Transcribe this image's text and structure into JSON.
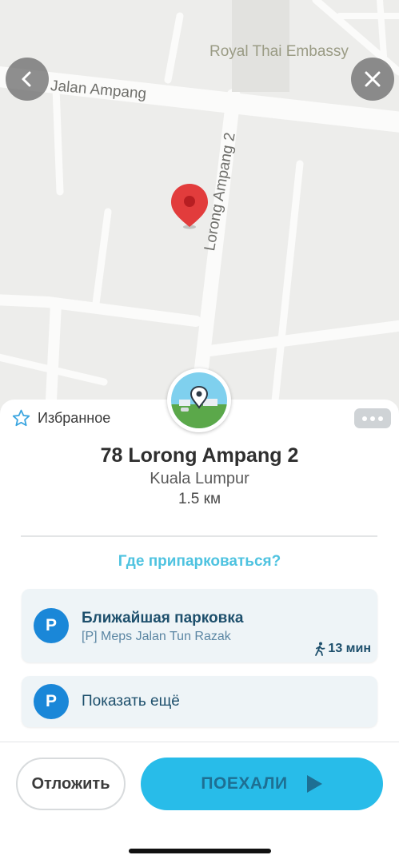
{
  "map": {
    "street_1": "Jalan Ampang",
    "street_2": "Lorong Ampang 2",
    "poi": "Royal Thai Embassy",
    "icons": {
      "back": "chevron-left-icon",
      "close": "close-icon",
      "pin": "map-pin-icon"
    }
  },
  "sheet": {
    "favorite_label": "Избранное",
    "address": "78 Lorong Ampang 2",
    "city": "Kuala Lumpur",
    "distance": "1.5 км",
    "parking_question": "Где припарковаться?",
    "nearest_parking": {
      "badge": "P",
      "title": "Ближайшая парковка",
      "subtitle": "[P] Meps Jalan Tun Razak",
      "walk_time": "13 мин"
    },
    "more_parking": {
      "badge": "P",
      "label": "Показать ещё"
    },
    "later_button": "Отложить",
    "go_button": "ПОЕХАЛИ"
  },
  "colors": {
    "accent": "#28bce9",
    "parking_badge": "#1a87d8",
    "pin": "#e23c3c",
    "map_bg": "#ededeb"
  }
}
